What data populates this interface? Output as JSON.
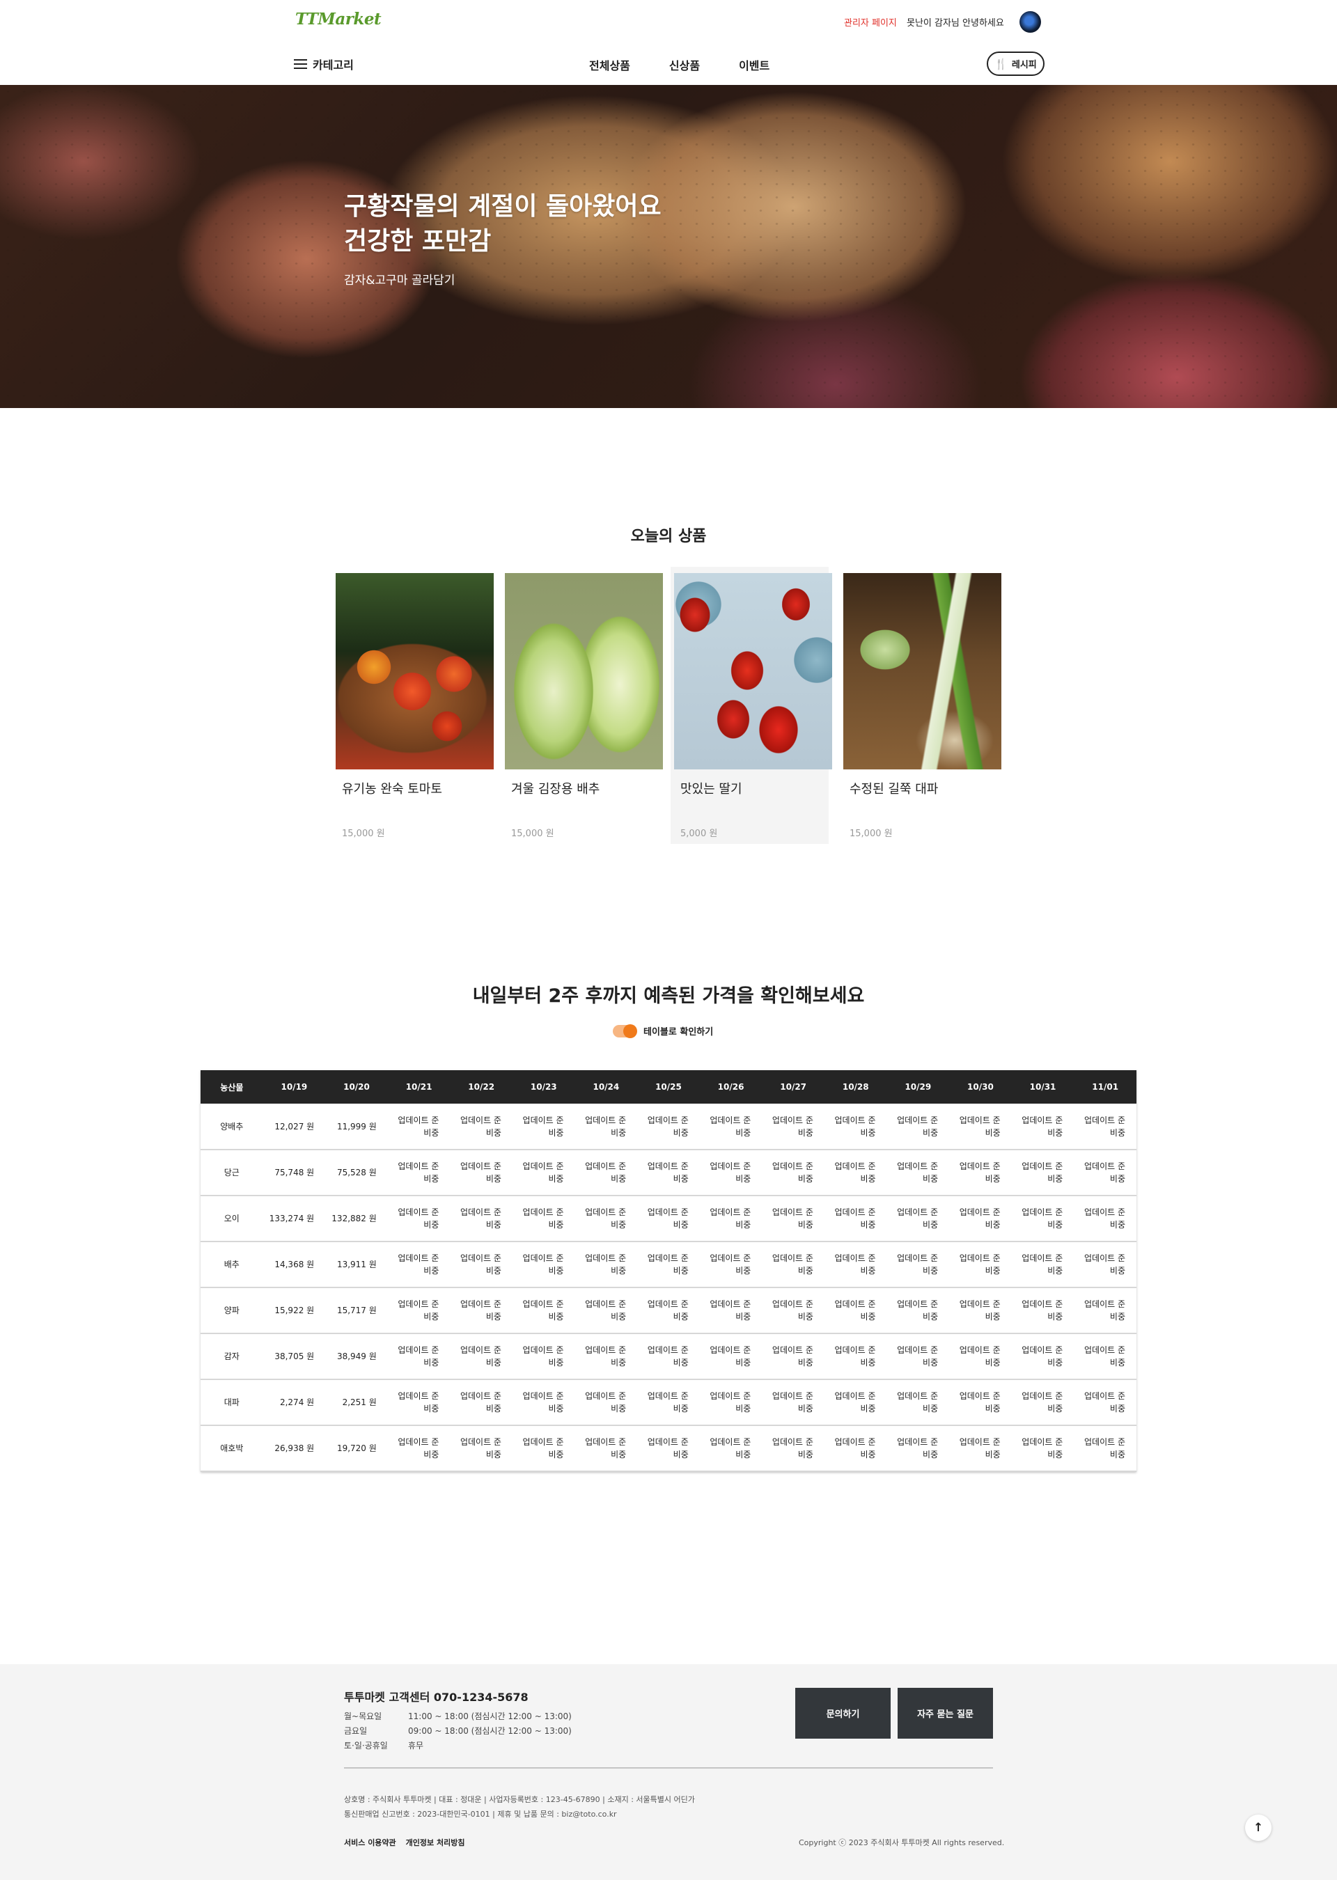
{
  "header": {
    "logo": "TTMarket",
    "admin_link": "관리자 페이지",
    "greeting": "못난이 감자님 안녕하세요",
    "category_label": "카테고리",
    "nav": [
      "전체상품",
      "신상품",
      "이벤트"
    ],
    "recipe_label": "레시피"
  },
  "hero": {
    "title_line1": "구황작물의 계절이 돌아왔어요",
    "title_line2": "건강한 포만감",
    "subtitle": "감자&고구마 골라담기"
  },
  "today": {
    "title": "오늘의 상품",
    "products": [
      {
        "name": "유기농 완숙 토마토",
        "price": "15,000 원"
      },
      {
        "name": "겨울 김장용 배추",
        "price": "15,000 원"
      },
      {
        "name": "맛있는 딸기",
        "price": "5,000 원"
      },
      {
        "name": "수정된 길쭉 대파",
        "price": "15,000 원"
      }
    ]
  },
  "prediction": {
    "title": "내일부터 2주 후까지 예측된 가격을 확인해보세요",
    "toggle_label": "테이블로 확인하기",
    "toggle_on": true,
    "pending_text": "업데이트 준비중",
    "columns": [
      "농산물",
      "10/19",
      "10/20",
      "10/21",
      "10/22",
      "10/23",
      "10/24",
      "10/25",
      "10/26",
      "10/27",
      "10/28",
      "10/29",
      "10/30",
      "10/31",
      "11/01"
    ],
    "rows": [
      {
        "name": "양배추",
        "d1": "12,027 원",
        "d2": "11,999 원"
      },
      {
        "name": "당근",
        "d1": "75,748 원",
        "d2": "75,528 원"
      },
      {
        "name": "오이",
        "d1": "133,274 원",
        "d2": "132,882 원"
      },
      {
        "name": "배추",
        "d1": "14,368 원",
        "d2": "13,911 원"
      },
      {
        "name": "양파",
        "d1": "15,922 원",
        "d2": "15,717 원"
      },
      {
        "name": "감자",
        "d1": "38,705 원",
        "d2": "38,949 원"
      },
      {
        "name": "대파",
        "d1": "2,274 원",
        "d2": "2,251 원"
      },
      {
        "name": "애호박",
        "d1": "26,938 원",
        "d2": "19,720 원"
      }
    ]
  },
  "footer": {
    "cs_title": "투투마켓 고객센터 070-1234-5678",
    "hours": [
      {
        "day": "월~목요일",
        "time": "11:00 ~ 18:00 (점심시간 12:00 ~ 13:00)"
      },
      {
        "day": "금요일",
        "time": "09:00 ~ 18:00 (점심시간 12:00 ~ 13:00)"
      },
      {
        "day": "토·일·공휴일",
        "time": "휴무"
      }
    ],
    "contact_button": "문의하기",
    "faq_button": "자주 묻는 질문",
    "company_line1": "상호명 : 주식회사 투투마켓  |  대표 : 정대운  |  사업자등록번호 : 123-45-67890  |  소재지 : 서울특별시 어딘가",
    "company_line2": "통신판매업 신고번호 : 2023-대한민국-0101  |  제휴 및 납품 문의 : biz@toto.co.kr",
    "terms_link": "서비스 이용약관",
    "privacy_link": "개인정보 처리방침",
    "copyright": "Copyright ⓒ 2023 주식회사 투투마켓 All rights reserved.",
    "top_button": "↑"
  },
  "colors": {
    "brand": "#5a9a2c",
    "admin": "#e0302a",
    "toggle": "#f07a1a",
    "table_header": "#252525",
    "footer_button": "#33373b"
  }
}
